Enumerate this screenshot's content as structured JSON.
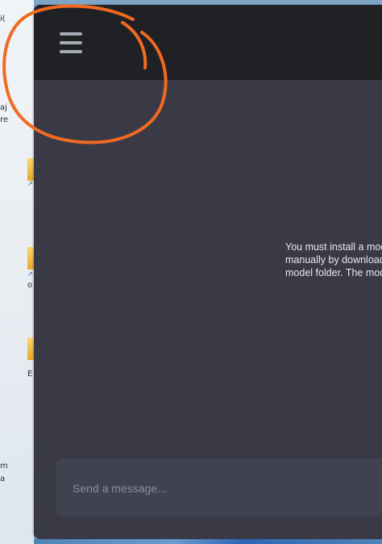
{
  "desktop": {
    "fragments": [
      "i(",
      "aj",
      "re",
      "z",
      "o",
      "E",
      "m",
      "a"
    ]
  },
  "topbar": {
    "menu_icon": "hamburger-menu-icon"
  },
  "main": {
    "notice_lines": [
      "You must install a model",
      "manually by downloadin",
      "model folder. The model"
    ]
  },
  "composer": {
    "placeholder": "Send a message..."
  },
  "annotation": {
    "color": "#f26a21"
  },
  "colors": {
    "topbar": "#202124",
    "content": "#393a46",
    "input": "#41424f"
  }
}
